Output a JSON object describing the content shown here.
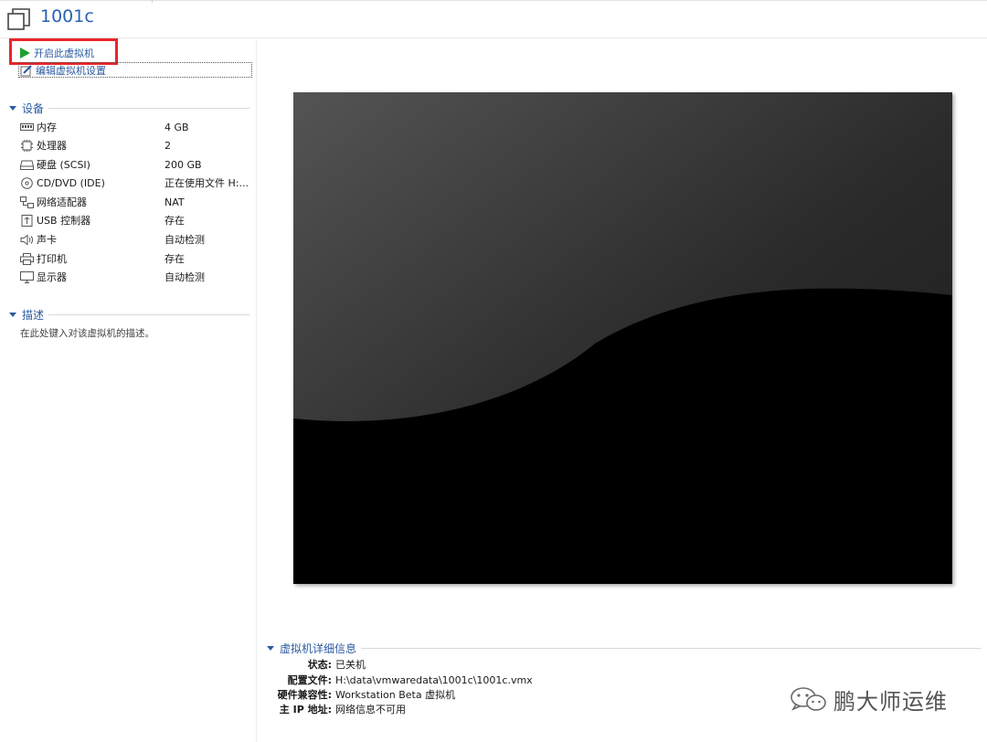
{
  "header": {
    "title": "1001c"
  },
  "actions": {
    "power_on": "开启此虚拟机",
    "edit_settings": "编辑虚拟机设置"
  },
  "devices": {
    "heading": "设备",
    "items": [
      {
        "name": "内存",
        "value": "4 GB",
        "icon": "memory-icon"
      },
      {
        "name": "处理器",
        "value": "2",
        "icon": "cpu-icon"
      },
      {
        "name": "硬盘 (SCSI)",
        "value": "200 GB",
        "icon": "hard-disk-icon"
      },
      {
        "name": "CD/DVD (IDE)",
        "value": "正在使用文件 H:...",
        "icon": "cd-dvd-icon"
      },
      {
        "name": "网络适配器",
        "value": "NAT",
        "icon": "network-icon"
      },
      {
        "name": "USB 控制器",
        "value": "存在",
        "icon": "usb-icon"
      },
      {
        "name": "声卡",
        "value": "自动检测",
        "icon": "speaker-icon"
      },
      {
        "name": "打印机",
        "value": "存在",
        "icon": "printer-icon"
      },
      {
        "name": "显示器",
        "value": "自动检测",
        "icon": "monitor-icon"
      }
    ]
  },
  "description": {
    "heading": "描述",
    "placeholder": "在此处键入对该虚拟机的描述。"
  },
  "details": {
    "heading": "虚拟机详细信息",
    "rows": [
      {
        "key": "状态:",
        "value": "已关机"
      },
      {
        "key": "配置文件:",
        "value": "H:\\data\\vmwaredata\\1001c\\1001c.vmx"
      },
      {
        "key": "硬件兼容性:",
        "value": "Workstation Beta 虚拟机"
      },
      {
        "key": "主 IP 地址:",
        "value": "网络信息不可用"
      }
    ]
  },
  "watermark": {
    "text": "鹏大师运维"
  },
  "colors": {
    "accent": "#2c5aa0",
    "title": "#2a62b4",
    "highlight": "#e8262a",
    "play": "#1fa02c"
  }
}
